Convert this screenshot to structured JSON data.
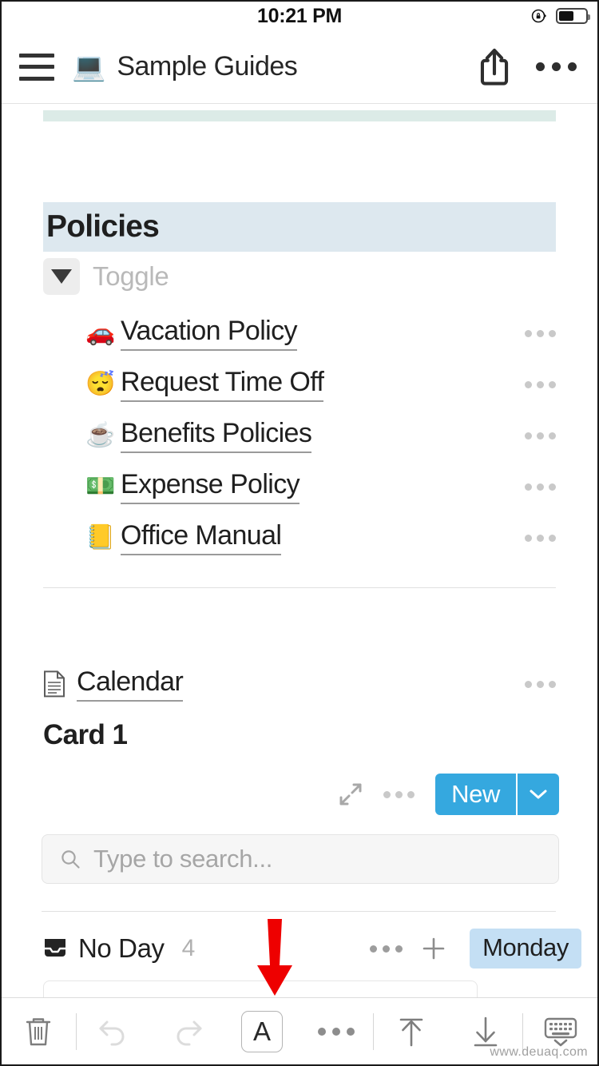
{
  "status_bar": {
    "time": "10:21 PM",
    "rotation_lock_icon": "rotation-lock-icon",
    "battery_icon": "battery-icon",
    "battery_level_percent": 55
  },
  "header": {
    "menu_icon": "hamburger-menu-icon",
    "page_emoji": "💻",
    "title": "Sample Guides",
    "share_icon": "share-icon",
    "more_icon": "more-options-icon"
  },
  "content": {
    "clipped_block_color": "#dcebe7",
    "policies": {
      "heading": "Policies",
      "banner_color": "#dde8ef",
      "toggle_placeholder": "Toggle",
      "toggle_icon": "triangle-down-icon",
      "items": [
        {
          "emoji": "🚗",
          "label": "Vacation Policy",
          "menu_icon": "more-options-icon"
        },
        {
          "emoji": "😴",
          "label": "Request Time Off",
          "menu_icon": "more-options-icon"
        },
        {
          "emoji": "☕",
          "label": "Benefits Policies",
          "menu_icon": "more-options-icon"
        },
        {
          "emoji": "💵",
          "label": "Expense Policy",
          "menu_icon": "more-options-icon"
        },
        {
          "emoji": "📒",
          "label": "Office Manual",
          "menu_icon": "more-options-icon"
        }
      ]
    },
    "calendar": {
      "doc_icon": "document-icon",
      "label": "Calendar",
      "menu_icon": "more-options-icon",
      "card_title": "Card 1",
      "expand_icon": "expand-diagonal-icon",
      "toolbar_more_icon": "more-options-icon",
      "new_button_label": "New",
      "new_button_caret_icon": "chevron-down-icon",
      "new_button_color": "#35a8df",
      "search_placeholder": "Type to search...",
      "search_icon": "search-icon",
      "day_group": {
        "inbox_icon": "inbox-icon",
        "label": "No Day",
        "count": "4",
        "more_icon": "more-options-icon",
        "add_icon": "plus-icon",
        "badge_label": "Monday",
        "badge_color": "#c4dff4"
      }
    }
  },
  "bottom_toolbar": {
    "items": [
      {
        "name": "delete-button",
        "icon": "trash-icon",
        "label": ""
      },
      {
        "name": "undo-button",
        "icon": "undo-arrow-icon",
        "label": ""
      },
      {
        "name": "redo-button",
        "icon": "redo-arrow-icon",
        "label": ""
      },
      {
        "name": "format-text-button",
        "icon": "letter-a-icon",
        "label": "A"
      },
      {
        "name": "more-actions-button",
        "icon": "more-options-icon",
        "label": ""
      },
      {
        "name": "move-to-top-button",
        "icon": "arrow-up-to-line-icon",
        "label": ""
      },
      {
        "name": "move-to-bottom-button",
        "icon": "arrow-down-to-line-icon",
        "label": ""
      },
      {
        "name": "hide-keyboard-button",
        "icon": "keyboard-hide-icon",
        "label": ""
      }
    ]
  },
  "annotation": {
    "arrow_icon": "red-down-arrow-annotation",
    "arrow_color": "#ee0000",
    "points_at": "format-text-button"
  },
  "watermark": "www.deuaq.com"
}
